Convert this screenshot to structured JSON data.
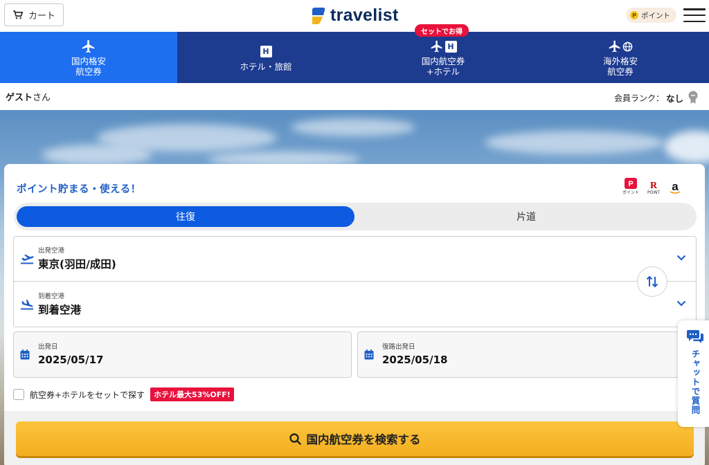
{
  "header": {
    "cart_label": "カート",
    "logo_text": "travelist",
    "points_label": "ポイント",
    "points_coin": "P"
  },
  "nav": {
    "tabs": [
      {
        "line1": "国内格安",
        "line2": "航空券",
        "active": true
      },
      {
        "line1": "ホテル・旅館",
        "line2": "",
        "active": false
      },
      {
        "line1": "国内航空券",
        "line2": "+ホテル",
        "active": false
      },
      {
        "line1": "海外格安",
        "line2": "航空券",
        "active": false
      }
    ],
    "set_badge": "セットでお得",
    "hotel_letter": "H"
  },
  "user": {
    "guest_name": "ゲスト",
    "guest_suffix": "さん",
    "rank_label": "会員ランク：",
    "rank_value": "なし"
  },
  "search": {
    "title": "ポイント貯まる・使える！",
    "pay_logos": {
      "paypay_sub": "ポイント",
      "rakuten_sub": "POINT",
      "rakuten_letter": "R",
      "paypay_letter": "P",
      "amazon_letter": "a"
    },
    "trip_types": {
      "round": "往復",
      "oneway": "片道"
    },
    "departure": {
      "label": "出発空港",
      "value": "東京(羽田/成田)"
    },
    "arrival": {
      "label": "到着空港",
      "value": "到着空港"
    },
    "outbound": {
      "label": "出発日",
      "value": "2025/05/17"
    },
    "return": {
      "label": "復路出発日",
      "value": "2025/05/18"
    },
    "set_option_label": "航空券+ホテルをセットで探す",
    "set_option_badge": "ホテル最大53%OFF!",
    "search_button": "国内航空券を検索する"
  },
  "chat": {
    "label": "チャットで質問"
  },
  "colors": {
    "nav_bg": "#1d3b8f",
    "nav_active": "#1e6ff0",
    "accent_blue": "#0d5be1",
    "badge_red": "#e8123c",
    "search_yellow": "#f4ae20"
  }
}
